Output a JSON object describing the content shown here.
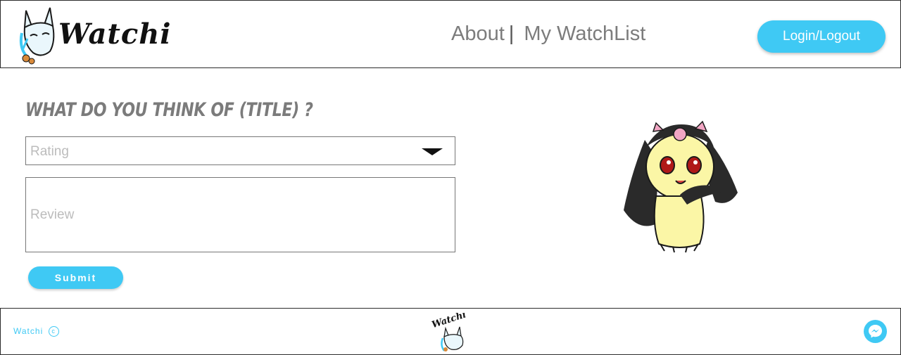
{
  "header": {
    "brand": "Watchi",
    "nav": [
      {
        "label": "About"
      },
      {
        "label": "My WatchList"
      }
    ],
    "nav_separator": "|",
    "login_label": "Login/Logout"
  },
  "form": {
    "heading": "What do you think of (title) ?",
    "rating_placeholder": "Rating",
    "review_placeholder": "Review",
    "submit_label": "Submit"
  },
  "footer": {
    "copyright_text": "Watchi",
    "copyright_symbol": "c"
  },
  "colors": {
    "accent": "#3fc9f4",
    "nav_text": "#7c7c7c",
    "border": "#2b2b2b",
    "placeholder": "#bcbcbc"
  },
  "icons": {
    "logo": "fox-mask-logo",
    "mascot": "anime-creature-illustration",
    "dropdown": "chevron-down-icon",
    "chat": "messenger-icon"
  }
}
